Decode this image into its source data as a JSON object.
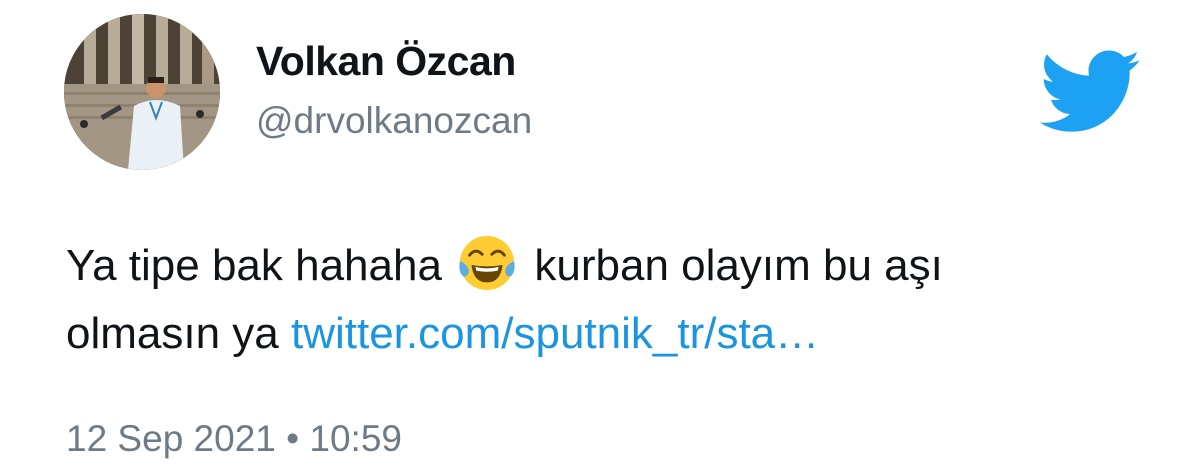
{
  "author": {
    "name": "Volkan Özcan",
    "handle": "@drvolkanozcan"
  },
  "brand": {
    "logo_icon": "twitter-bird-icon",
    "color": "#1da1f2"
  },
  "tweet": {
    "text_line1_before_emoji": "Ya tipe bak hahaha",
    "emoji": "face-with-tears-of-joy-icon",
    "text_line1_after_emoji": " kurban olayım bu aşı",
    "text_line2": "olmasın ya ",
    "link_text": "twitter.com/sputnik_tr/sta…",
    "link_color": "#1b95e0"
  },
  "meta": {
    "date": "12 Sep 2021",
    "separator": "•",
    "time": "10:59"
  }
}
